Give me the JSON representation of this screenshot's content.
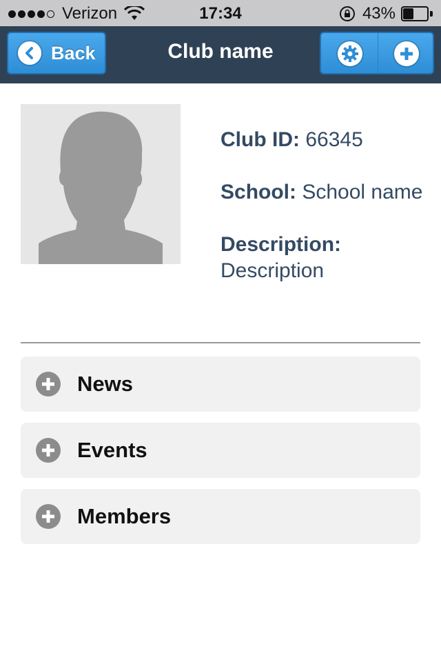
{
  "status_bar": {
    "carrier": "Verizon",
    "time": "17:34",
    "battery": "43%",
    "battery_level": 0.43,
    "icons": [
      "signal-dots-icon",
      "wifi-icon",
      "rotation-lock-icon",
      "battery-icon"
    ]
  },
  "nav": {
    "back_label": "Back",
    "title": "Club name",
    "icons": [
      "chevron-left-icon",
      "gear-icon",
      "plus-icon"
    ],
    "accent_color": "#3a9be3",
    "bar_color": "#2f4155"
  },
  "club": {
    "id_label": "Club ID:",
    "id_value": "66345",
    "school_label": "School:",
    "school_value": "School name",
    "description_label": "Description:",
    "description_value": "Description",
    "avatar_icon": "person-silhouette-icon"
  },
  "sections": [
    {
      "label": "News",
      "icon": "plus-circle-icon"
    },
    {
      "label": "Events",
      "icon": "plus-circle-icon"
    },
    {
      "label": "Members",
      "icon": "plus-circle-icon"
    }
  ]
}
